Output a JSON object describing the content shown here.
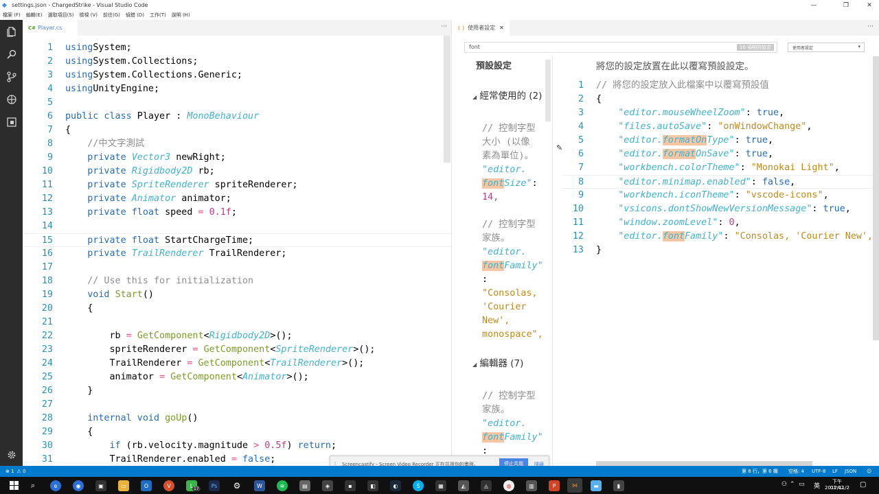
{
  "window": {
    "title": "settings.json - ChargedStrike - Visual Studio Code",
    "minimize": "—",
    "maximize": "❐",
    "close": "✕"
  },
  "menu": [
    "檔案 (F)",
    "編輯(E)",
    "選取項目(S)",
    "檢視 (V)",
    "前往(G)",
    "偵錯 (D)",
    "工作(T)",
    "說明 (H)"
  ],
  "left_editor": {
    "tab_label": "Player.cs",
    "tab_icon": "C#",
    "more": "···",
    "lines": [
      {
        "n": "1",
        "t": [
          [
            "kw",
            "using"
          ],
          [
            "",
            "System;"
          ]
        ]
      },
      {
        "n": "2",
        "t": [
          [
            "kw",
            "using"
          ],
          [
            "",
            "System.Collections;"
          ]
        ]
      },
      {
        "n": "3",
        "t": [
          [
            "kw",
            "using"
          ],
          [
            "",
            "System.Collections.Generic;"
          ]
        ]
      },
      {
        "n": "4",
        "t": [
          [
            "kw",
            "using"
          ],
          [
            "",
            "UnityEngine;"
          ]
        ]
      },
      {
        "n": "5",
        "t": []
      },
      {
        "n": "6",
        "t": [
          [
            "kw",
            "public class"
          ],
          [
            "",
            " Player : "
          ],
          [
            "cls",
            "MonoBehaviour"
          ]
        ]
      },
      {
        "n": "7",
        "t": [
          [
            "",
            "{"
          ]
        ]
      },
      {
        "n": "8",
        "t": [
          [
            "",
            "    "
          ],
          [
            "cm",
            "//中文字測試"
          ]
        ]
      },
      {
        "n": "9",
        "t": [
          [
            "",
            "    "
          ],
          [
            "kw",
            "private"
          ],
          [
            "",
            " "
          ],
          [
            "cls",
            "Vector3"
          ],
          [
            "",
            " newRight;"
          ]
        ]
      },
      {
        "n": "10",
        "t": [
          [
            "",
            "    "
          ],
          [
            "kw",
            "private"
          ],
          [
            "",
            " "
          ],
          [
            "cls",
            "Rigidbody2D"
          ],
          [
            "",
            " rb;"
          ]
        ]
      },
      {
        "n": "11",
        "t": [
          [
            "",
            "    "
          ],
          [
            "kw",
            "private"
          ],
          [
            "",
            " "
          ],
          [
            "cls",
            "SpriteRenderer"
          ],
          [
            "",
            " spriteRenderer;"
          ]
        ]
      },
      {
        "n": "12",
        "t": [
          [
            "",
            "    "
          ],
          [
            "kw",
            "private"
          ],
          [
            "",
            " "
          ],
          [
            "cls",
            "Animator"
          ],
          [
            "",
            " animator;"
          ]
        ]
      },
      {
        "n": "13",
        "t": [
          [
            "",
            "    "
          ],
          [
            "kw",
            "private float"
          ],
          [
            "",
            " speed "
          ],
          [
            "pm",
            "="
          ],
          [
            "",
            " "
          ],
          [
            "num",
            "0.1f"
          ],
          [
            "",
            ";"
          ]
        ]
      },
      {
        "n": "14",
        "t": []
      },
      {
        "n": "15",
        "t": [
          [
            "",
            "    "
          ],
          [
            "kw",
            "private float"
          ],
          [
            "",
            " StartChargeTime;"
          ]
        ]
      },
      {
        "n": "16",
        "t": [
          [
            "",
            "    "
          ],
          [
            "kw",
            "private"
          ],
          [
            "",
            " "
          ],
          [
            "cls",
            "TrailRenderer"
          ],
          [
            "",
            " TrailRenderer;"
          ]
        ]
      },
      {
        "n": "17",
        "t": []
      },
      {
        "n": "18",
        "t": [
          [
            "",
            "    "
          ],
          [
            "cm",
            "// Use this for initialization"
          ]
        ]
      },
      {
        "n": "19",
        "t": [
          [
            "",
            "    "
          ],
          [
            "kw",
            "void"
          ],
          [
            "",
            " "
          ],
          [
            "fn",
            "Start"
          ],
          [
            "",
            "()"
          ]
        ]
      },
      {
        "n": "20",
        "t": [
          [
            "",
            "    {"
          ]
        ]
      },
      {
        "n": "21",
        "t": []
      },
      {
        "n": "22",
        "t": [
          [
            "",
            "        rb "
          ],
          [
            "pm",
            "="
          ],
          [
            "",
            " "
          ],
          [
            "fn",
            "GetComponent"
          ],
          [
            "",
            "<"
          ],
          [
            "cls",
            "Rigidbody2D"
          ],
          [
            "",
            ">();"
          ]
        ]
      },
      {
        "n": "23",
        "t": [
          [
            "",
            "        spriteRenderer "
          ],
          [
            "pm",
            "="
          ],
          [
            "",
            " "
          ],
          [
            "fn",
            "GetComponent"
          ],
          [
            "",
            "<"
          ],
          [
            "cls",
            "SpriteRenderer"
          ],
          [
            "",
            ">();"
          ]
        ]
      },
      {
        "n": "24",
        "t": [
          [
            "",
            "        TrailRenderer "
          ],
          [
            "pm",
            "="
          ],
          [
            "",
            " "
          ],
          [
            "fn",
            "GetComponent"
          ],
          [
            "",
            "<"
          ],
          [
            "cls",
            "TrailRenderer"
          ],
          [
            "",
            ">();"
          ]
        ]
      },
      {
        "n": "25",
        "t": [
          [
            "",
            "        animator "
          ],
          [
            "pm",
            "="
          ],
          [
            "",
            " "
          ],
          [
            "fn",
            "GetComponent"
          ],
          [
            "",
            "<"
          ],
          [
            "cls",
            "Animator"
          ],
          [
            "",
            ">();"
          ]
        ]
      },
      {
        "n": "26",
        "t": [
          [
            "",
            "    }"
          ]
        ]
      },
      {
        "n": "27",
        "t": []
      },
      {
        "n": "28",
        "t": [
          [
            "",
            "    "
          ],
          [
            "kw",
            "internal void"
          ],
          [
            "",
            " "
          ],
          [
            "fn",
            "goUp"
          ],
          [
            "",
            "()"
          ]
        ]
      },
      {
        "n": "29",
        "t": [
          [
            "",
            "    {"
          ]
        ]
      },
      {
        "n": "30",
        "t": [
          [
            "",
            "        "
          ],
          [
            "kw",
            "if"
          ],
          [
            "",
            " (rb.velocity.magnitude "
          ],
          [
            "pm",
            ">"
          ],
          [
            "",
            " "
          ],
          [
            "num",
            "0.5f"
          ],
          [
            "",
            ") "
          ],
          [
            "kw",
            "return"
          ],
          [
            "",
            ";"
          ]
        ]
      },
      {
        "n": "31",
        "t": [
          [
            "",
            "        TrailRenderer.enabled "
          ],
          [
            "pm",
            "="
          ],
          [
            "",
            " "
          ],
          [
            "kw",
            "false"
          ],
          [
            "",
            ";"
          ]
        ]
      }
    ]
  },
  "right_editor": {
    "tab_label": "使用者設定",
    "tab_icon": "{ }",
    "more": "···",
    "search_value": "font",
    "match_badge": "16 項相符設定",
    "scope_select": "使用者設定",
    "defaults_title": "預設設定",
    "sections": [
      {
        "title": "經常使用的 (2)"
      },
      {
        "title": "編輯器 (7)"
      }
    ],
    "default_snippets": [
      {
        "comment1": "// 控制字型",
        "comment2": "大小 (以像",
        "comment3": "素為單位)。",
        "key1": "\"editor.",
        "key2a": "font",
        "key2b": "Size\"",
        "colon": ":",
        "value": "14,"
      },
      {
        "comment1": "// 控制字型",
        "comment2": "家族。",
        "key1": "\"editor.",
        "key2a": "font",
        "key2b": "Family\"",
        "colon": ":",
        "v1": "\"Consolas,",
        "v2": "'Courier",
        "v3": "New',",
        "v4": "monospace\","
      },
      {
        "comment1": "// 控制字型",
        "comment2": "家族。",
        "key1": "\"editor.",
        "key2a": "font",
        "key2b": "Family\"",
        "colon": ":"
      }
    ],
    "user_header": "將您的設定放置在此以覆寫預設設定。",
    "json_lines": [
      {
        "n": "1",
        "t": [
          [
            "cm",
            "// 將您的設定放入此檔案中以覆寫預設值"
          ]
        ]
      },
      {
        "n": "2",
        "t": [
          [
            "",
            "{"
          ]
        ]
      },
      {
        "n": "3",
        "t": [
          [
            "",
            "    "
          ],
          [
            "key",
            "\"editor.mouseWheelZoom\""
          ],
          [
            "",
            ": "
          ],
          [
            "kw",
            "true"
          ],
          [
            "",
            ","
          ]
        ]
      },
      {
        "n": "4",
        "t": [
          [
            "",
            "    "
          ],
          [
            "key",
            "\"files.autoSave\""
          ],
          [
            "",
            ": "
          ],
          [
            "str",
            "\"onWindowChange\""
          ],
          [
            "",
            ","
          ]
        ]
      },
      {
        "n": "5",
        "t": [
          [
            "",
            "    "
          ],
          [
            "key",
            "\"editor."
          ],
          [
            "key hl",
            "formatOn"
          ],
          [
            "key",
            "Type\""
          ],
          [
            "",
            ": "
          ],
          [
            "kw",
            "true"
          ],
          [
            "",
            ","
          ]
        ]
      },
      {
        "n": "6",
        "t": [
          [
            "",
            "    "
          ],
          [
            "key",
            "\"editor."
          ],
          [
            "key hl",
            "format"
          ],
          [
            "key",
            "OnSave\""
          ],
          [
            "",
            ": "
          ],
          [
            "kw",
            "true"
          ],
          [
            "",
            ","
          ]
        ]
      },
      {
        "n": "7",
        "t": [
          [
            "",
            "    "
          ],
          [
            "key",
            "\"workbench.colorTheme\""
          ],
          [
            "",
            ": "
          ],
          [
            "str",
            "\"Monokai Light\""
          ],
          [
            "",
            ","
          ]
        ]
      },
      {
        "n": "8",
        "t": [
          [
            "",
            "    "
          ],
          [
            "key",
            "\"editor.minimap.enabled\""
          ],
          [
            "",
            ": "
          ],
          [
            "kw",
            "false"
          ],
          [
            "",
            ","
          ]
        ]
      },
      {
        "n": "9",
        "t": [
          [
            "",
            "    "
          ],
          [
            "key",
            "\"workbench.iconTheme\""
          ],
          [
            "",
            ": "
          ],
          [
            "str",
            "\"vscode-icons\""
          ],
          [
            "",
            ","
          ]
        ]
      },
      {
        "n": "10",
        "t": [
          [
            "",
            "    "
          ],
          [
            "key",
            "\"vsicons.dontShowNewVersionMessage\""
          ],
          [
            "",
            ": "
          ],
          [
            "kw",
            "true"
          ],
          [
            "",
            ","
          ]
        ]
      },
      {
        "n": "11",
        "t": [
          [
            "",
            "    "
          ],
          [
            "key",
            "\"window.zoomLevel\""
          ],
          [
            "",
            ": "
          ],
          [
            "num",
            "0"
          ],
          [
            "",
            ","
          ]
        ]
      },
      {
        "n": "12",
        "t": [
          [
            "",
            "    "
          ],
          [
            "key",
            "\"editor."
          ],
          [
            "key hl",
            "font"
          ],
          [
            "key",
            "Family\""
          ],
          [
            "",
            ": "
          ],
          [
            "str",
            "\"Consolas, 'Courier New',"
          ]
        ]
      },
      {
        "n": "13",
        "t": [
          [
            "",
            "}"
          ]
        ]
      }
    ]
  },
  "notification": {
    "text": "Screencastify - Screen Video Recorder 正在共用你的畫面。",
    "stop_button": "停止共用",
    "hide_button": "隱藏"
  },
  "status": {
    "errors": "⊗ 1",
    "warnings": "⚠ 0",
    "position": "第 8 行，第 6 欄",
    "spaces": "空格: 4",
    "encoding": "UTF-8",
    "eol": "LF",
    "language": "JSON"
  },
  "taskbar": {
    "time": "下午 01:42",
    "date": "2017/11/2",
    "ime": "英",
    "badge": "17"
  },
  "colors": {
    "accent": "#007acc",
    "activitybar": "#2c2c2c",
    "taskbar": "#101010"
  }
}
